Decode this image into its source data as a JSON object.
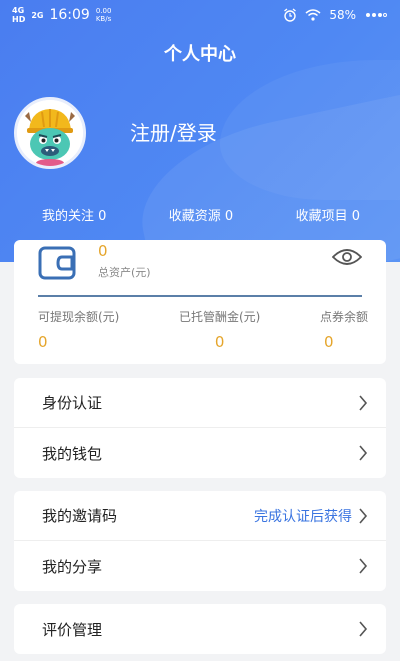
{
  "status_bar": {
    "network_top": "4G",
    "network_bottom": "HD",
    "network2": "2G",
    "time": "16:09",
    "speed_top": "0.00",
    "speed_bottom": "KB/s",
    "battery": "58%"
  },
  "header": {
    "title": "个人中心",
    "login_label": "注册/登录"
  },
  "stats": [
    {
      "label": "我的关注 0"
    },
    {
      "label": "收藏资源 0"
    },
    {
      "label": "收藏项目 0"
    }
  ],
  "assets": {
    "total_value": "0",
    "total_label": "总资产(元)",
    "balances": [
      {
        "label": "可提现余额(元)",
        "value": "0"
      },
      {
        "label": "已托管酬金(元)",
        "value": "0"
      },
      {
        "label": "点券余额",
        "value": "0"
      }
    ]
  },
  "menu": {
    "group1": [
      {
        "label": "身份认证"
      },
      {
        "label": "我的钱包"
      }
    ],
    "group2": [
      {
        "label": "我的邀请码",
        "hint": "完成认证后获得"
      },
      {
        "label": "我的分享"
      }
    ],
    "group3": [
      {
        "label": "评价管理"
      }
    ]
  },
  "colors": {
    "header_blue": "#4f88f3",
    "accent_orange": "#e5a52b",
    "link_blue": "#3a74e0"
  }
}
